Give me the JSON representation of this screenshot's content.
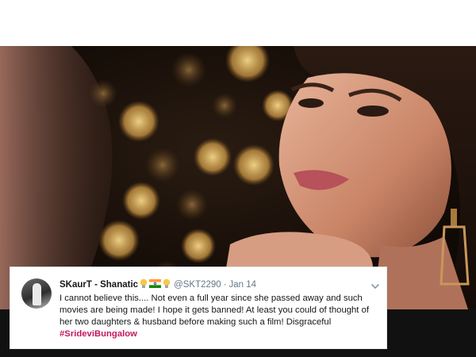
{
  "tweet": {
    "display_name": "SKaurT - Shanatic",
    "name_emojis": [
      "bulb-icon",
      "india-flag-icon",
      "bulb-icon"
    ],
    "handle": "@SKT2290",
    "separator": "·",
    "date": "Jan 14",
    "text": "I cannot believe this.... Not even a full year since she passed away and such movies are being made! I hope it gets banned! At least you could of thought of her two daughters & husband before making such a film! Disgraceful",
    "hashtag": "#SrideviBungalow",
    "menu_icon": "chevron-down-icon"
  },
  "colors": {
    "hashtag": "#c2185b",
    "handle": "#657786",
    "name": "#14171a",
    "card_border": "#e1e8ed"
  }
}
